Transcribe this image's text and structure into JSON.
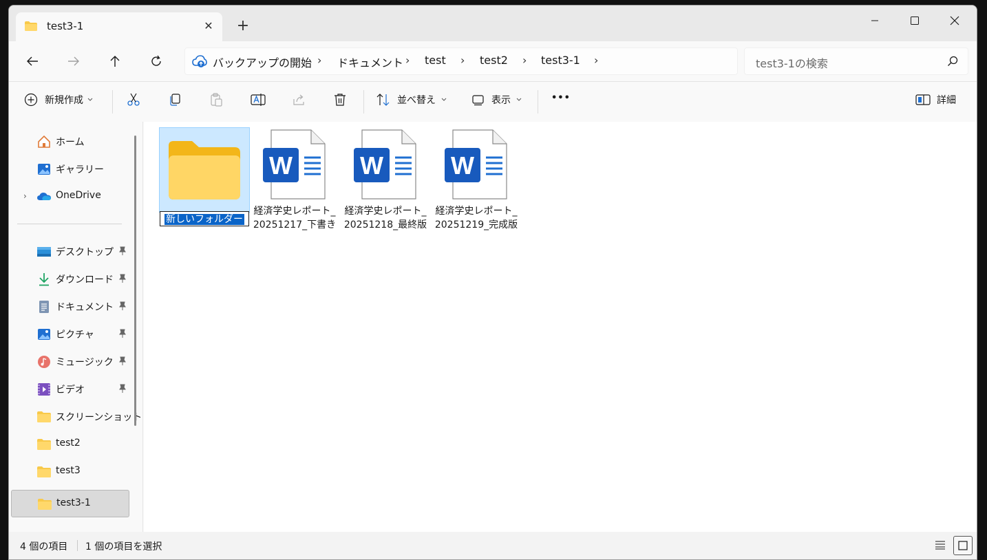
{
  "tab": {
    "title": "test3-1",
    "close_glyph": "✕",
    "new_glyph": "+"
  },
  "address": {
    "crumbs": [
      "バックアップの開始",
      "ドキュメント",
      "test",
      "test2",
      "test3-1"
    ],
    "chevron": "›"
  },
  "search": {
    "placeholder": "test3-1の検索"
  },
  "toolbar": {
    "new_label": "新規作成",
    "sort_label": "並べ替え",
    "view_label": "表示",
    "more_glyph": "•••",
    "details_label": "詳細"
  },
  "sidebar": {
    "items": [
      {
        "label": "ホーム",
        "icon": "home-icon"
      },
      {
        "label": "ギャラリー",
        "icon": "gallery-icon"
      },
      {
        "label": "OneDrive",
        "icon": "onedrive-icon",
        "expander": "›"
      },
      {
        "label": "デスクトップ",
        "icon": "desktop-icon",
        "pinned": true
      },
      {
        "label": "ダウンロード",
        "icon": "download-icon",
        "pinned": true
      },
      {
        "label": "ドキュメント",
        "icon": "documents-icon",
        "pinned": true
      },
      {
        "label": "ピクチャ",
        "icon": "pictures-icon",
        "pinned": true
      },
      {
        "label": "ミュージック",
        "icon": "music-icon",
        "pinned": true
      },
      {
        "label": "ビデオ",
        "icon": "video-icon",
        "pinned": true
      },
      {
        "label": "スクリーンショット",
        "icon": "folder-icon"
      },
      {
        "label": "test2",
        "icon": "folder-icon"
      },
      {
        "label": "test3",
        "icon": "folder-icon"
      },
      {
        "label": "test3-1",
        "icon": "folder-icon",
        "selected": true
      }
    ]
  },
  "files": [
    {
      "name": "新しいフォルダー",
      "type": "folder",
      "renaming": true
    },
    {
      "name": "経済学史レポート_20251217_下書き",
      "type": "word"
    },
    {
      "name": "経済学史レポート_20251218_最終版",
      "type": "word"
    },
    {
      "name": "経済学史レポート_20251219_完成版",
      "type": "word"
    }
  ],
  "status": {
    "item_count": "4 個の項目",
    "selected_count": "1 個の項目を選択"
  },
  "colors": {
    "accent": "#0a64c8",
    "folder": "#f8c94a",
    "word": "#185abd",
    "selection": "#cce8ff"
  }
}
